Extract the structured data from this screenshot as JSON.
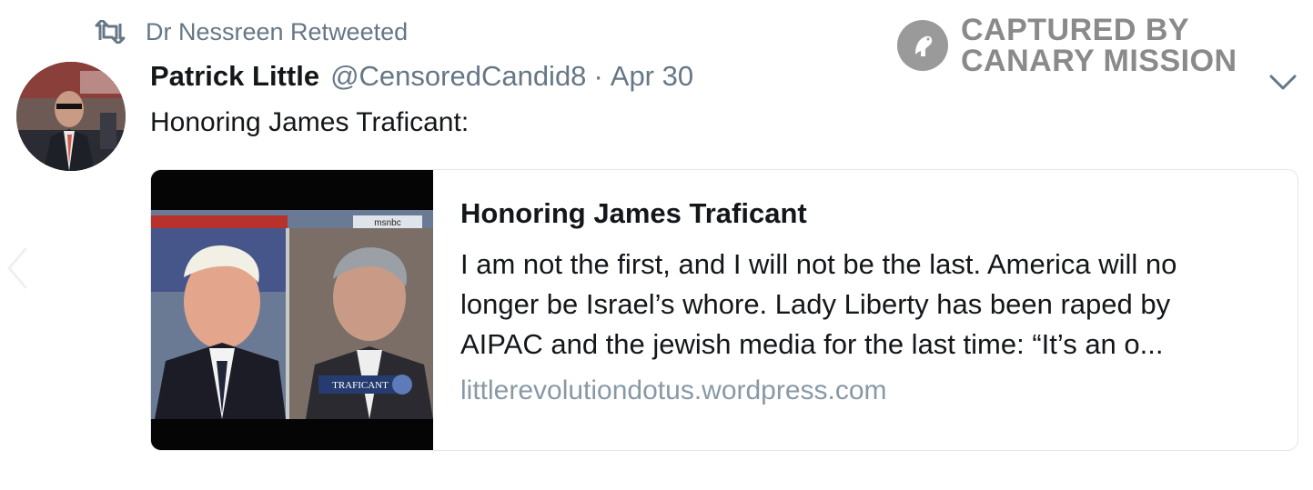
{
  "retweet": {
    "icon": "retweet-icon",
    "text": "Dr Nessreen Retweeted"
  },
  "watermark": {
    "icon": "canary-logo-icon",
    "line1": "CAPTURED BY",
    "line2": "CANARY MISSION"
  },
  "tweet": {
    "author_name": "Patrick Little",
    "handle": "@CensoredCandid8",
    "separator": "·",
    "date": "Apr 30",
    "text": "Honoring James Traficant:",
    "menu_icon": "chevron-down-icon",
    "avatar_icon": "avatar"
  },
  "card": {
    "title": "Honoring James Traficant",
    "description_lines": [
      "I am not the first, and I will not be the last. America will no",
      "longer be Israel’s whore. Lady Liberty has been raped by",
      "AIPAC and the jewish media for the last time: “It’s an o..."
    ],
    "domain": "littlerevolutiondotus.wordpress.com",
    "image_caption": "TRAFICANT",
    "image_network": "msnbc"
  },
  "colors": {
    "text": "#14171a",
    "muted": "#657786",
    "border": "#e1e8ed",
    "watermark": "#8a8a8a"
  }
}
